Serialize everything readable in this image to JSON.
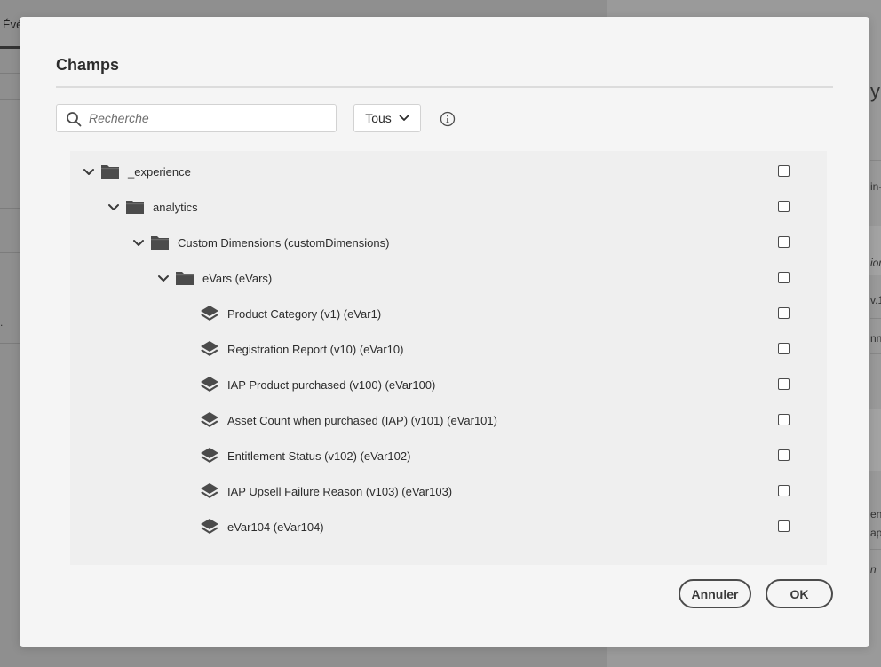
{
  "background": {
    "tab_label": "Évé",
    "left_stub": ".",
    "right_stubs": [
      "y",
      "in-",
      "ior",
      "v.1",
      "nn",
      "en",
      "ap",
      "n"
    ]
  },
  "modal": {
    "title": "Champs",
    "search": {
      "placeholder": "Recherche",
      "value": ""
    },
    "filter": {
      "selected": "Tous"
    },
    "tree": [
      {
        "label": "_experience",
        "type": "folder",
        "expanded": true,
        "depth": 0
      },
      {
        "label": "analytics",
        "type": "folder",
        "expanded": true,
        "depth": 1
      },
      {
        "label": "Custom Dimensions (customDimensions)",
        "type": "folder",
        "expanded": true,
        "depth": 2
      },
      {
        "label": "eVars (eVars)",
        "type": "folder",
        "expanded": true,
        "depth": 3
      },
      {
        "label": "Product Category (v1) (eVar1)",
        "type": "field",
        "depth": 4
      },
      {
        "label": "Registration Report (v10) (eVar10)",
        "type": "field",
        "depth": 4
      },
      {
        "label": "IAP Product purchased (v100) (eVar100)",
        "type": "field",
        "depth": 4
      },
      {
        "label": "Asset Count when purchased (IAP) (v101) (eVar101)",
        "type": "field",
        "depth": 4
      },
      {
        "label": "Entitlement Status (v102) (eVar102)",
        "type": "field",
        "depth": 4
      },
      {
        "label": "IAP Upsell Failure Reason (v103) (eVar103)",
        "type": "field",
        "depth": 4
      },
      {
        "label": "eVar104 (eVar104)",
        "type": "field",
        "depth": 4
      }
    ],
    "buttons": {
      "cancel": "Annuler",
      "ok": "OK"
    }
  },
  "icons": {
    "search": "search-icon",
    "filter_chevron": "chevron-down-icon",
    "info": "info-icon",
    "folder": "folder-icon",
    "field": "layers-icon",
    "expand": "chevron-down-icon",
    "checkbox": "checkbox"
  },
  "colors": {
    "overlay": "#9b9b9b",
    "modal_bg": "#f5f5f5",
    "tree_bg": "#efefef",
    "icon": "#4b4b4b",
    "text": "#2c2c2c"
  }
}
